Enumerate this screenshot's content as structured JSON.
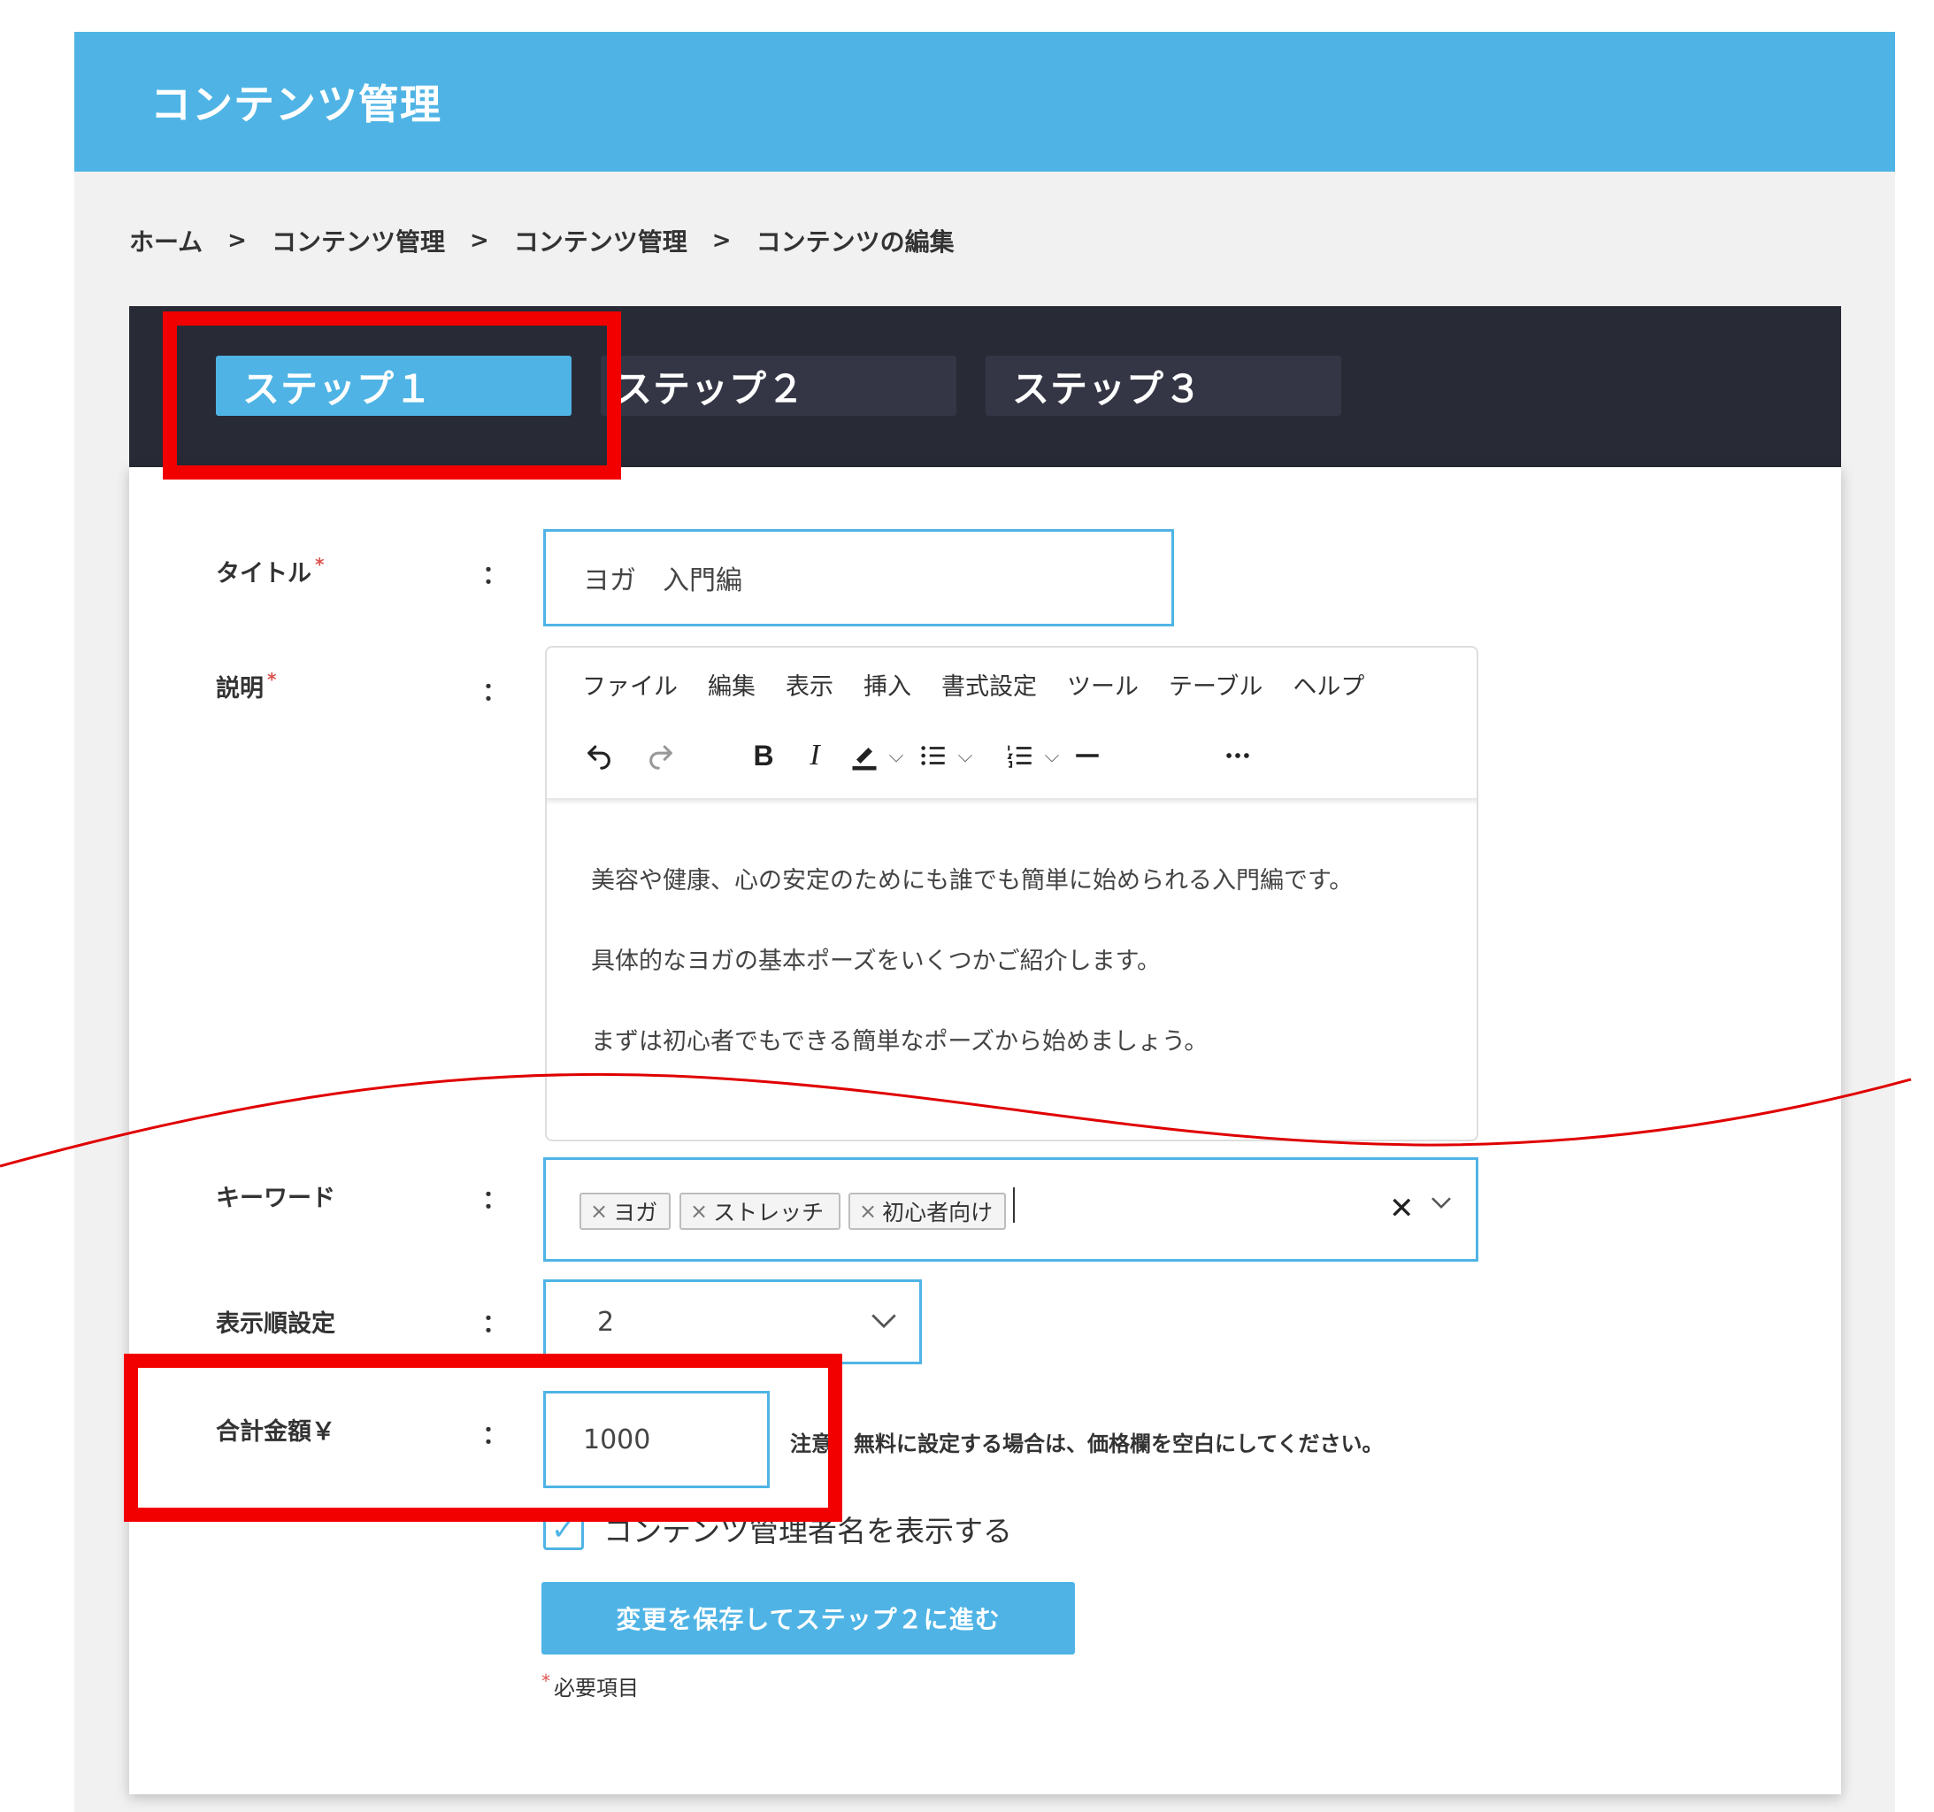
{
  "header": {
    "title": "コンテンツ管理"
  },
  "breadcrumb": {
    "items": [
      "ホーム",
      "コンテンツ管理",
      "コンテンツ管理",
      "コンテンツの編集"
    ],
    "separator": ">"
  },
  "tabs": [
    {
      "label": "ステップ１",
      "active": true
    },
    {
      "label": "ステップ２",
      "active": false
    },
    {
      "label": "ステップ３",
      "active": false
    }
  ],
  "form": {
    "colon": "：",
    "required_mark": "*",
    "title": {
      "label": "タイトル",
      "value": "ヨガ　入門編"
    },
    "description": {
      "label": "説明",
      "menu": [
        "ファイル",
        "編集",
        "表示",
        "挿入",
        "書式設定",
        "ツール",
        "テーブル",
        "ヘルプ"
      ],
      "toolbar": [
        "undo-icon",
        "redo-icon",
        "bold-icon",
        "italic-icon",
        "highlight-icon",
        "bullet-list-icon",
        "numbered-list-icon",
        "horizontal-rule-icon",
        "more-icon"
      ],
      "paragraphs": [
        "美容や健康、心の安定のためにも誰でも簡単に始められる入門編です。",
        "具体的なヨガの基本ポーズをいくつかご紹介します。",
        "まずは初心者でもできる簡単なポーズから始めましょう。"
      ]
    },
    "keywords": {
      "label": "キーワード",
      "tags": [
        "ヨガ",
        "ストレッチ",
        "初心者向け"
      ]
    },
    "display_order": {
      "label": "表示順設定",
      "value": "2"
    },
    "price": {
      "label": "合計金額￥",
      "value": "1000",
      "note": "注意：無料に設定する場合は、価格欄を空白にしてください。"
    },
    "show_admin": {
      "label": "コンテンツ管理者名を表示する",
      "checked": true
    },
    "save_button": "変更を保存してステップ２に進む",
    "required_note": "必要項目"
  },
  "colors": {
    "accent": "#4fb4e5",
    "tabbar": "#282a36",
    "highlight": "#f20000"
  }
}
